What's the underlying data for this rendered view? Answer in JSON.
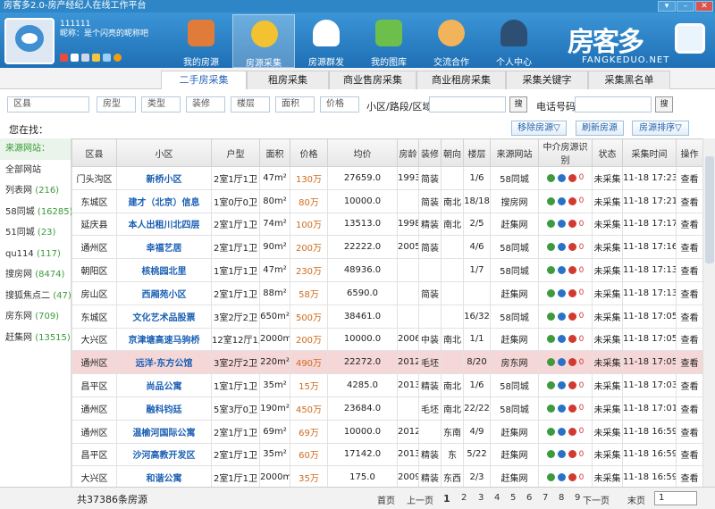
{
  "title": "房客多2.0-房产经纪人在线工作平台",
  "user": {
    "id": "111111",
    "nick": "昵称：是个闪亮的昵称吧"
  },
  "nav": [
    {
      "label": "我的房源"
    },
    {
      "label": "房源采集"
    },
    {
      "label": "房源群发"
    },
    {
      "label": "我的图库"
    },
    {
      "label": "交流合作"
    },
    {
      "label": "个人中心"
    }
  ],
  "logo": {
    "text": "房客多",
    "sub": "FANGKEDUO.NET"
  },
  "tabs": [
    "二手房采集",
    "租房采集",
    "商业售房采集",
    "商业租房采集",
    "采集关键字",
    "采集黑名单"
  ],
  "filters": {
    "district": "区县",
    "type1": "房型",
    "type2": "类型",
    "decor": "装修",
    "floor": "楼层",
    "area": "面积",
    "price": "价格",
    "road_label": "小区/路段/区域",
    "search": "搜",
    "phone_label": "电话号码",
    "search2": "搜"
  },
  "location_label": "您在找：",
  "actions": {
    "remove": "移除房源▽",
    "refresh": "刷新房源",
    "sort": "房源排序▽"
  },
  "sidebar": [
    {
      "label": "来源网站："
    },
    {
      "label": "全部网站"
    },
    {
      "label": "列表网",
      "count": "(216)"
    },
    {
      "label": "58同城",
      "count": "(16285)"
    },
    {
      "label": "51同城",
      "count": "(23)"
    },
    {
      "label": "qu114",
      "count": "(117)"
    },
    {
      "label": "搜房网",
      "count": "(8474)"
    },
    {
      "label": "搜狐焦点二",
      "count": "(47)"
    },
    {
      "label": "房东网",
      "count": "(709)"
    },
    {
      "label": "赶集网",
      "count": "(13515)"
    }
  ],
  "columns": [
    "区县",
    "小区",
    "户型",
    "面积",
    "价格",
    "均价",
    "房龄",
    "装修",
    "朝向",
    "楼层",
    "来源网站",
    "中介房源识别",
    "状态",
    "采集时间",
    "操作"
  ],
  "rows": [
    [
      "门头沟区",
      "新桥小区",
      "2室1厅1卫",
      "47m²",
      "130万",
      "27659.0",
      "1993",
      "简装",
      "",
      "1/6",
      "58同城",
      "",
      "未采集",
      "11-18 17:23",
      "查看"
    ],
    [
      "东城区",
      "建才（北京）信息",
      "1室0厅0卫",
      "80m²",
      "80万",
      "10000.0",
      "",
      "简装",
      "南北",
      "18/18",
      "搜房网",
      "",
      "未采集",
      "11-18 17:21",
      "查看"
    ],
    [
      "延庆县",
      "本人出租川北四层",
      "2室1厅1卫",
      "74m²",
      "100万",
      "13513.0",
      "1998",
      "精装",
      "南北",
      "2/5",
      "赶集网",
      "",
      "未采集",
      "11-18 17:17",
      "查看"
    ],
    [
      "通州区",
      "幸福艺居",
      "2室1厅1卫",
      "90m²",
      "200万",
      "22222.0",
      "2005",
      "简装",
      "",
      "4/6",
      "58同城",
      "",
      "未采集",
      "11-18 17:16",
      "查看"
    ],
    [
      "朝阳区",
      "核桃园北里",
      "1室1厅1卫",
      "47m²",
      "230万",
      "48936.0",
      "",
      "",
      "",
      "1/7",
      "58同城",
      "",
      "未采集",
      "11-18 17:13",
      "查看"
    ],
    [
      "房山区",
      "西厢苑小区",
      "2室1厅1卫",
      "88m²",
      "58万",
      "6590.0",
      "",
      "简装",
      "",
      "",
      "赶集网",
      "",
      "未采集",
      "11-18 17:13",
      "查看"
    ],
    [
      "东城区",
      "文化艺术品股票",
      "3室2厅2卫",
      "650m²",
      "500万",
      "38461.0",
      "",
      "",
      "",
      "16/32",
      "58同城",
      "",
      "未采集",
      "11-18 17:05",
      "查看"
    ],
    [
      "大兴区",
      "京津塘高速马驹桥",
      "12室12厅1卫",
      "2000m²",
      "200万",
      "10000.0",
      "2006",
      "中装",
      "南北",
      "1/1",
      "赶集网",
      "",
      "未采集",
      "11-18 17:05",
      "查看"
    ],
    [
      "通州区",
      "远洋·东方公馆",
      "3室2厅2卫",
      "220m²",
      "490万",
      "22272.0",
      "2012",
      "毛坯",
      "",
      "8/20",
      "房东网",
      "",
      "未采集",
      "11-18 17:05",
      "查看"
    ],
    [
      "昌平区",
      "尚品公寓",
      "1室1厅1卫",
      "35m²",
      "15万",
      "4285.0",
      "2013",
      "精装",
      "南北",
      "1/6",
      "58同城",
      "",
      "未采集",
      "11-18 17:03",
      "查看"
    ],
    [
      "通州区",
      "融科钧廷",
      "5室3厅0卫",
      "190m²",
      "450万",
      "23684.0",
      "",
      "毛坯",
      "南北",
      "22/22",
      "58同城",
      "",
      "未采集",
      "11-18 17:01",
      "查看"
    ],
    [
      "通州区",
      "温榆河国际公寓",
      "2室1厅1卫",
      "69m²",
      "69万",
      "10000.0",
      "2012",
      "",
      "东南",
      "4/9",
      "赶集网",
      "",
      "未采集",
      "11-18 16:59",
      "查看"
    ],
    [
      "昌平区",
      "沙河高教开发区",
      "2室1厅1卫",
      "35m²",
      "60万",
      "17142.0",
      "2013",
      "精装",
      "东",
      "5/22",
      "赶集网",
      "",
      "未采集",
      "11-18 16:59",
      "查看"
    ],
    [
      "大兴区",
      "和谐公寓",
      "2室1厅1卫",
      "2000m²",
      "35万",
      "175.0",
      "2009",
      "精装",
      "东西",
      "2/3",
      "赶集网",
      "",
      "未采集",
      "11-18 16:59",
      "查看"
    ],
    [
      "密云县",
      "杏日水岸",
      "1室0厅1卫",
      "15m²",
      "34万",
      "22666.0",
      "2009",
      "",
      "南",
      "2/10",
      "赶集网",
      "",
      "未采集",
      "11-18 16:58",
      "查看"
    ]
  ],
  "highlight_row": 8,
  "footer": {
    "total": "共37386条房源",
    "first": "首页",
    "prev": "上一页",
    "pages": [
      "1",
      "2",
      "3",
      "4",
      "5",
      "6",
      "7",
      "8",
      "9"
    ],
    "next": "下一页",
    "last": "末页",
    "select": "1"
  }
}
